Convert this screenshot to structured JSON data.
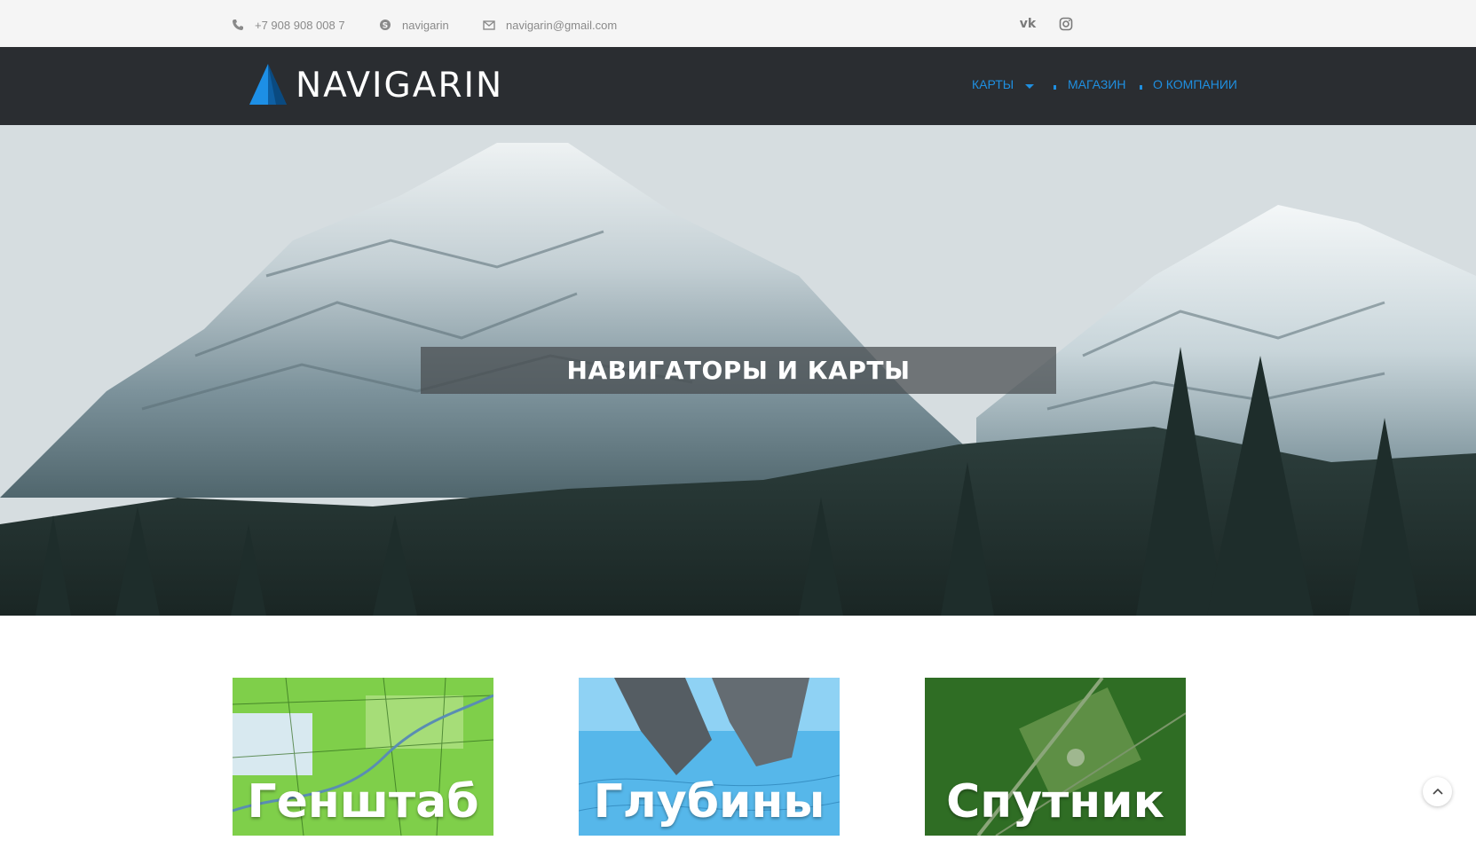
{
  "topbar": {
    "phone": "+7 908 908 008 7",
    "skype": "navigarin",
    "email": "navigarin@gmail.com",
    "phone_icon": "phone-icon",
    "skype_icon": "skype-icon",
    "email_icon": "envelope-icon",
    "social": [
      "vk-icon",
      "instagram-icon"
    ],
    "vk_glyph": "vk"
  },
  "header": {
    "logo_text": "NAVIGARIN",
    "nav": [
      {
        "label": "КАРТЫ"
      },
      {
        "label": "МАГАЗИН"
      },
      {
        "label": "О КОМПАНИИ"
      }
    ]
  },
  "hero": {
    "title": "НАВИГАТОРЫ И КАРТЫ"
  },
  "cards": [
    {
      "label": "Генштаб"
    },
    {
      "label": "Глубины"
    },
    {
      "label": "Спутник"
    }
  ],
  "colors": {
    "nav_bg": "#2a2d31",
    "accent": "#1f8fe0",
    "topbar_bg": "#f5f5f5"
  }
}
